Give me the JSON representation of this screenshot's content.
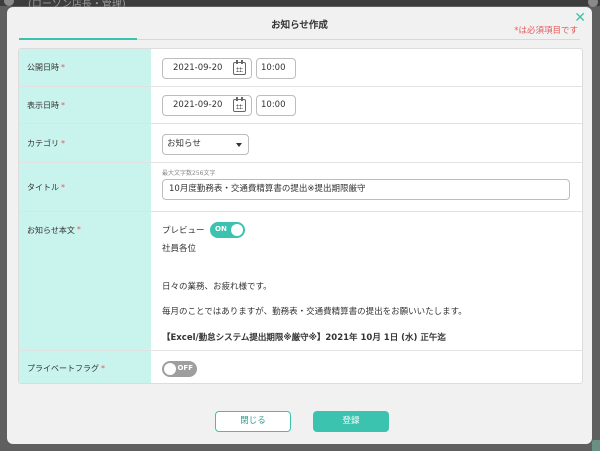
{
  "background": {
    "snippet_text": "(ローソン店長・管理)"
  },
  "modal": {
    "title": "お知らせ作成",
    "required_note": "*は必須項目です",
    "close_symbol": "✕"
  },
  "form": {
    "publish_datetime": {
      "label": "公開日時",
      "required_mark": "*",
      "date": "2021-09-20",
      "time": "10:00"
    },
    "display_datetime": {
      "label": "表示日時",
      "required_mark": "*",
      "date": "2021-09-20",
      "time": "10:00"
    },
    "category": {
      "label": "カテゴリ",
      "required_mark": "*",
      "selected": "お知らせ"
    },
    "title": {
      "label": "タイトル",
      "required_mark": "*",
      "char_limit": "最大文字数256文字",
      "value": "10月度勤務表・交通費精算書の提出※提出期限厳守"
    },
    "body": {
      "label": "お知らせ本文",
      "required_mark": "*",
      "preview_label": "プレビュー",
      "preview_toggle": "ON",
      "lines": [
        "社員各位",
        "日々の業務、お疲れ様です。",
        "毎月のことではありますが、勤務表・交通費精算書の提出をお願いいたします。",
        "【Excel/勤怠システム提出期限※厳守※】2021年 10月 1日 (水) 正午迄"
      ]
    },
    "private_flag": {
      "label": "プライベートフラグ",
      "required_mark": "*",
      "toggle": "OFF"
    }
  },
  "footer": {
    "close_label": "閉じる",
    "save_label": "登録"
  },
  "colors": {
    "accent": "#3cc3b0",
    "label_bg": "#c9f4ee",
    "required": "#e35a5a"
  }
}
